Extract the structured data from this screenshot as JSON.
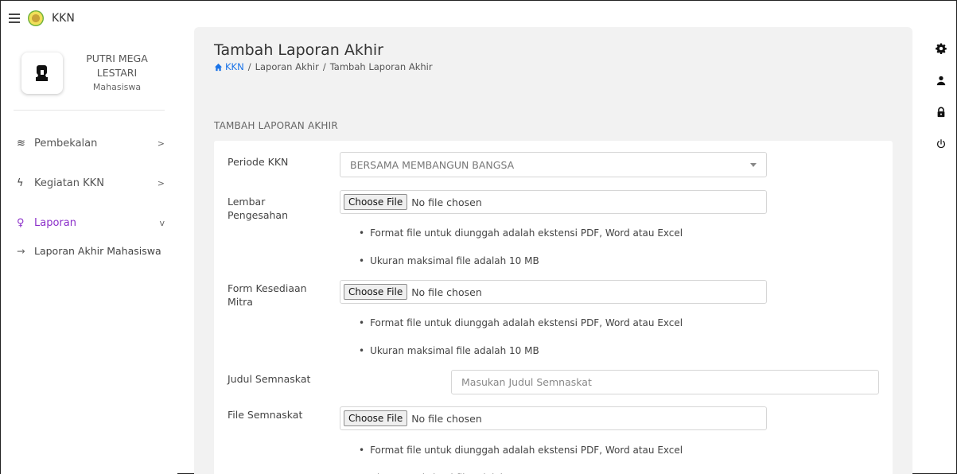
{
  "brand": {
    "name": "KKN"
  },
  "profile": {
    "name": "PUTRI MEGA LESTARI",
    "role": "Mahasiswa"
  },
  "sidebar": {
    "items": [
      {
        "label": "Pembekalan",
        "icon": "layers-icon",
        "chevron": ">"
      },
      {
        "label": "Kegiatan KKN",
        "icon": "activity-icon",
        "chevron": ">"
      },
      {
        "label": "Laporan",
        "icon": "search-doc-icon",
        "chevron": "v"
      }
    ],
    "sub_items": [
      {
        "label": "Laporan Akhir Mahasiswa"
      }
    ]
  },
  "header": {
    "title": "Tambah Laporan Akhir",
    "breadcrumb": [
      "KKN",
      "Laporan Akhir",
      "Tambah Laporan Akhir"
    ]
  },
  "form": {
    "section_title": "TAMBAH LAPORAN AKHIR",
    "periode": {
      "label": "Periode KKN",
      "value": "BERSAMA MEMBANGUN BANGSA"
    },
    "lembar": {
      "label": "Lembar Pengesahan"
    },
    "mitra": {
      "label": "Form Kesediaan Mitra"
    },
    "judul": {
      "label": "Judul Semnaskat",
      "placeholder": "Masukan Judul Semnaskat"
    },
    "file_semnaskat": {
      "label": "File Semnaskat"
    },
    "file_button": "Choose File",
    "file_status": "No file chosen",
    "note_format": "Format file untuk diunggah adalah ekstensi PDF, Word atau Excel",
    "note_size": "Ukuran maksimal file adalah 10 MB"
  },
  "colors": {
    "accent": "#8b2fc9",
    "link": "#1a73e8",
    "panel": "#f2f2f2"
  }
}
